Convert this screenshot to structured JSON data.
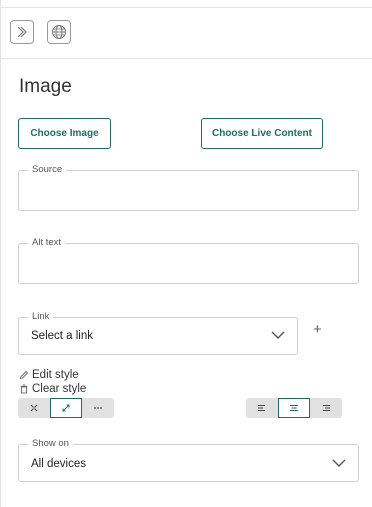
{
  "panel": {
    "title": "Image"
  },
  "toolbar": {
    "expand_icon": "double-chevron-right-icon",
    "language_icon": "globe-icon"
  },
  "buttons": {
    "choose_image": "Choose Image",
    "choose_live_content": "Choose Live Content"
  },
  "fields": {
    "source": {
      "label": "Source",
      "value": ""
    },
    "alt_text": {
      "label": "Alt text",
      "value": ""
    },
    "link": {
      "label": "Link",
      "selected": "Select a link"
    },
    "show_on": {
      "label": "Show on",
      "selected": "All devices"
    }
  },
  "style_links": {
    "edit": "Edit style",
    "clear": "Clear style"
  },
  "size_options": {
    "items": [
      "shrink-icon",
      "expand-icon",
      "ellipsis-icon"
    ],
    "active": 1
  },
  "align_options": {
    "items": [
      "align-left-icon",
      "align-center-icon",
      "align-right-icon"
    ],
    "active": 1
  },
  "colors": {
    "accent": "#1f6e63",
    "border": "#cfcfcf"
  }
}
